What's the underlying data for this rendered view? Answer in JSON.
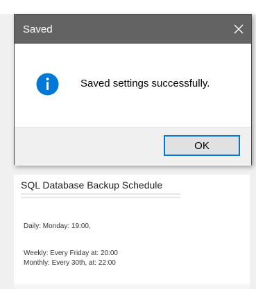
{
  "dialog": {
    "title": "Saved",
    "message": "Saved settings successfully.",
    "ok_label": "OK"
  },
  "panel": {
    "title": "SQL Database Backup Schedule",
    "daily": "Daily: Monday: 19:00,",
    "weekly": "Weekly: Every Friday at: 20:00",
    "monthly": "Monthly: Every 30th, at: 22:00"
  },
  "colors": {
    "titlebar": "#636363",
    "info_icon": "#0078d7",
    "button_border": "#0078d7"
  }
}
